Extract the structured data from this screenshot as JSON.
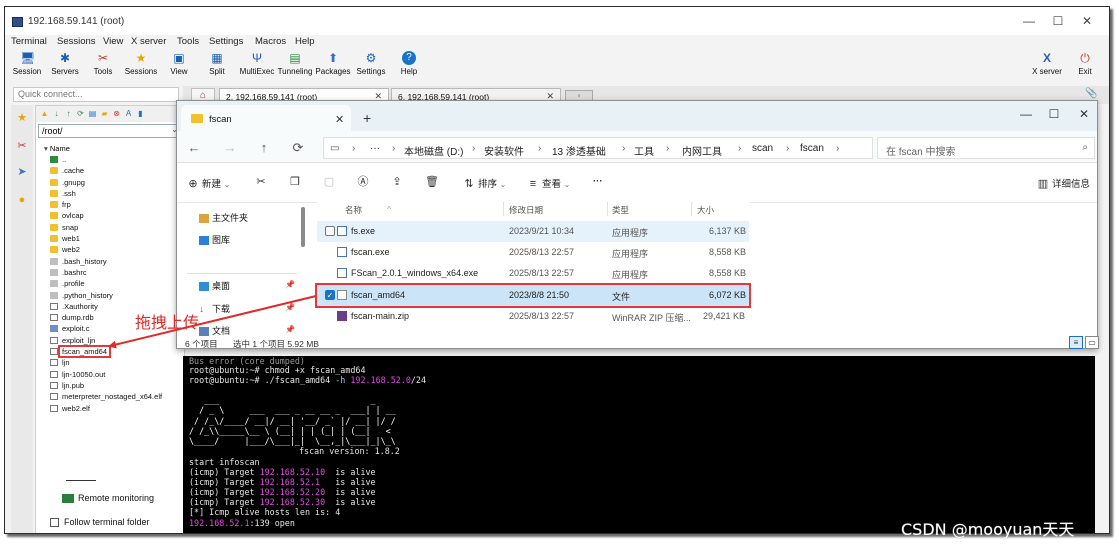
{
  "moba": {
    "title": "192.168.59.141 (root)",
    "menu": [
      "Terminal",
      "Sessions",
      "View",
      "X server",
      "Tools",
      "Settings",
      "Macros",
      "Help"
    ],
    "toolbar": [
      "Session",
      "Servers",
      "Tools",
      "Sessions",
      "View",
      "Split",
      "MultiExec",
      "Tunneling",
      "Packages",
      "Settings",
      "Help"
    ],
    "toolbar_right": [
      "X server",
      "Exit"
    ],
    "quick_connect_placeholder": "Quick connect...",
    "tabs": [
      "2. 192.168.59.141 (root)",
      "6. 192.168.59.141 (root)"
    ],
    "path": "/root/",
    "file_header": "Name",
    "files": [
      {
        "name": "..",
        "type": "up"
      },
      {
        "name": ".cache",
        "type": "folder"
      },
      {
        "name": ".gnupg",
        "type": "folder"
      },
      {
        "name": ".ssh",
        "type": "folder"
      },
      {
        "name": "frp",
        "type": "folder"
      },
      {
        "name": "ovlcap",
        "type": "folder"
      },
      {
        "name": "snap",
        "type": "folder"
      },
      {
        "name": "web1",
        "type": "folder"
      },
      {
        "name": "web2",
        "type": "folder"
      },
      {
        "name": ".bash_history",
        "type": "hidden"
      },
      {
        "name": ".bashrc",
        "type": "hidden"
      },
      {
        "name": ".profile",
        "type": "hidden"
      },
      {
        "name": ".python_history",
        "type": "hidden"
      },
      {
        "name": ".Xauthority",
        "type": "file"
      },
      {
        "name": "dump.rdb",
        "type": "file"
      },
      {
        "name": "exploit.c",
        "type": "file"
      },
      {
        "name": "exploit_ljn",
        "type": "file"
      },
      {
        "name": "fscan_amd64",
        "type": "file"
      },
      {
        "name": "ljn",
        "type": "file"
      },
      {
        "name": "ljn-10050.out",
        "type": "file"
      },
      {
        "name": "ljn.pub",
        "type": "file"
      },
      {
        "name": "meterpreter_nostaged_x64.elf",
        "type": "file"
      },
      {
        "name": "web2.elf",
        "type": "file"
      }
    ],
    "remote_monitoring": "Remote monitoring",
    "follow_folder": "Follow terminal folder"
  },
  "annotation": "拖拽上传",
  "explorer": {
    "tab_title": "fscan",
    "breadcrumbs": [
      "本地磁盘 (D:)",
      "安装软件",
      "13 渗透基础",
      "工具",
      "内网工具",
      "scan",
      "fscan"
    ],
    "search_placeholder": "在 fscan 中搜索",
    "commands": {
      "new": "新建",
      "sort": "排序",
      "view": "查看",
      "details": "详细信息"
    },
    "nav": [
      {
        "label": "主文件夹",
        "pinned": false
      },
      {
        "label": "图库",
        "pinned": false
      },
      {
        "label": "桌面",
        "pinned": true
      },
      {
        "label": "下载",
        "pinned": true
      },
      {
        "label": "文档",
        "pinned": true
      }
    ],
    "columns": [
      "名称",
      "修改日期",
      "类型",
      "大小"
    ],
    "rows": [
      {
        "name": "fs.exe",
        "date": "2023/9/21 10:34",
        "type": "应用程序",
        "size": "6,137 KB",
        "state": "hover"
      },
      {
        "name": "fscan.exe",
        "date": "2025/8/13 22:57",
        "type": "应用程序",
        "size": "8,558 KB",
        "state": ""
      },
      {
        "name": "FScan_2.0.1_windows_x64.exe",
        "date": "2025/8/13 22:57",
        "type": "应用程序",
        "size": "8,558 KB",
        "state": ""
      },
      {
        "name": "fscan_amd64",
        "date": "2023/8/8 21:50",
        "type": "文件",
        "size": "6,072 KB",
        "state": "selected"
      },
      {
        "name": "fscan-main.zip",
        "date": "2025/8/13 22:57",
        "type": "WinRAR ZIP 压缩...",
        "size": "29,421 KB",
        "state": ""
      }
    ],
    "status": {
      "count": "6 个项目",
      "selected": "选中 1 个项目  5.92 MB"
    }
  },
  "terminal": {
    "lines": [
      {
        "prompt": "root@ubuntu:~# ",
        "text": "chmod +x fscan_amd64"
      },
      {
        "prompt": "root@ubuntu:~# ",
        "text": "./fscan_amd64 ",
        "arg": "-h",
        "ip": "192.168.52.0",
        "rest": "/24"
      }
    ],
    "version": "fscan version: 1.8.2",
    "start": "start infoscan",
    "alive": [
      {
        "prefix": "(icmp) Target ",
        "ip": "192.168.52.10",
        "suffix": "  is alive"
      },
      {
        "prefix": "(icmp) Target ",
        "ip": "192.168.52.1",
        "suffix": "   is alive"
      },
      {
        "prefix": "(icmp) Target ",
        "ip": "192.168.52.20",
        "suffix": "  is alive"
      },
      {
        "prefix": "(icmp) Target ",
        "ip": "192.168.52.30",
        "suffix": "  is alive"
      }
    ],
    "summary": "[*] Icmp alive hosts len is: 4",
    "open_ip": "192.168.52.1",
    "open_rest": ":139 open"
  },
  "watermark": "CSDN @mooyuan天天"
}
